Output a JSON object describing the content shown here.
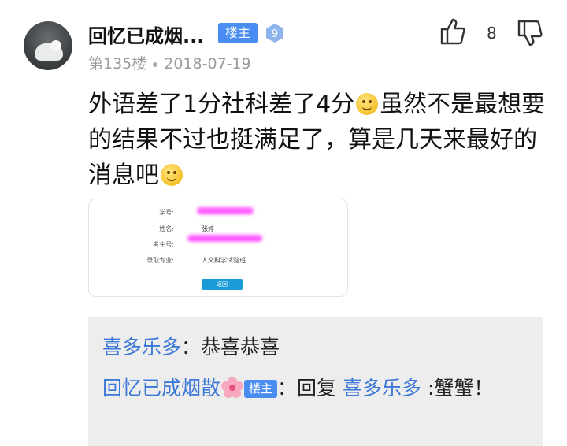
{
  "post": {
    "author": "回忆已成烟...",
    "owner_badge": "楼主",
    "level": "9",
    "floor": "第135楼",
    "date": "2018-07-19",
    "likes": "8",
    "content_1": "外语差了1分社科差了4分",
    "content_2": "虽然不是最想要的结果不过也挺满足了，算是几天来最好的消息吧"
  },
  "screenshot": {
    "label_id": "学号:",
    "label_name": "姓名:",
    "name_value": "张婷",
    "label_exam": "考生号:",
    "label_major": "录取专业:",
    "major_value": "人文科学试验班",
    "button": "返回"
  },
  "replies": {
    "r1_user": "喜多乐多",
    "r1_sep": "：",
    "r1_text": "恭喜恭喜",
    "r2_user": "回忆已成烟散",
    "r2_badge": "楼主",
    "r2_sep": "：",
    "r2_prefix": "回复 ",
    "r2_target": "喜多乐多",
    "r2_text": " :蟹蟹！"
  },
  "colors": {
    "link": "#3b78d8",
    "badge": "#4a8df2",
    "reply_bg": "#ededed"
  }
}
